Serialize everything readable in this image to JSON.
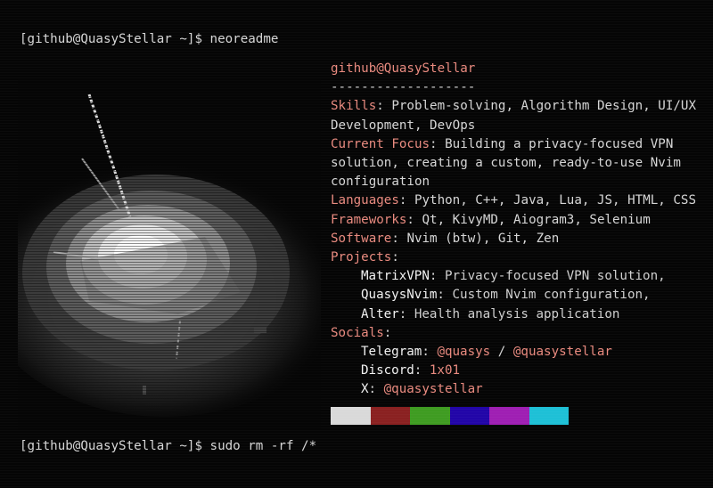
{
  "terminal": {
    "prompt1": "[github@QuasyStellar ~]$ neoreadme",
    "prompt2": "[github@QuasyStellar ~]$ sudo rm -rf /*"
  },
  "info": {
    "user": "github@QuasyStellar",
    "separator": "-------------------",
    "skills_label": "Skills",
    "skills_line1": "Problem-solving, Algorithm Design, UI/UX",
    "skills_line2": "Development, DevOps",
    "focus_label": "Current Focus",
    "focus_line1": "Building a privacy-focused VPN",
    "focus_line2": "solution, creating a custom, ready-to-use Nvim",
    "focus_line3": "configuration",
    "languages_label": "Languages",
    "languages_value": "Python, C++, Java, Lua, JS, HTML, CSS",
    "frameworks_label": "Frameworks",
    "frameworks_value": "Qt, KivyMD, Aiogram3, Selenium",
    "software_label": "Software",
    "software_value": "Nvim (btw), Git, Zen",
    "projects_label": "Projects",
    "projects": [
      {
        "name": "MatrixVPN",
        "desc": "Privacy-focused VPN solution,"
      },
      {
        "name": "QuasysNvim",
        "desc": "Custom Nvim configuration,"
      },
      {
        "name": "Alter",
        "desc": "Health analysis application"
      }
    ],
    "socials_label": "Socials",
    "telegram_label": "Telegram",
    "telegram_handle1": "@quasys",
    "telegram_sep": "/",
    "telegram_handle2": "@quasystellar",
    "discord_label": "Discord",
    "discord_handle": "1x01",
    "x_label": "X",
    "x_handle": "@quasystellar"
  },
  "palette": [
    "#d9d9d9",
    "#8a2121",
    "#3f9c22",
    "#2205a8",
    "#9f1fb3",
    "#1ec0d6"
  ]
}
